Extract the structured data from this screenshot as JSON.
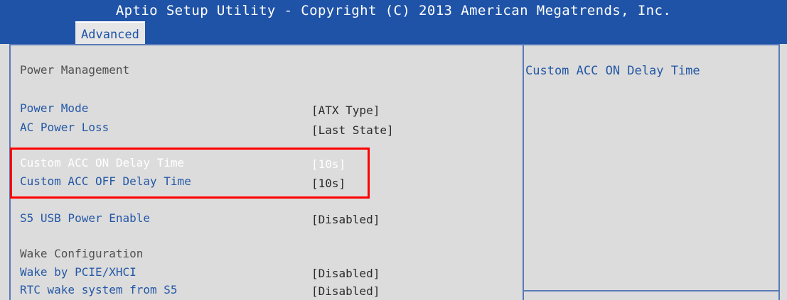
{
  "window": {
    "title": "Aptio Setup Utility - Copyright (C) 2013 American Megatrends, Inc."
  },
  "tabs": [
    {
      "label": "Advanced"
    }
  ],
  "section": {
    "title": "Power Management"
  },
  "settings": {
    "power_mode": {
      "label": "Power Mode",
      "value": "[ATX Type]"
    },
    "ac_power_loss": {
      "label": "AC Power Loss",
      "value": "[Last State]"
    },
    "acc_on_delay": {
      "label": "Custom ACC ON Delay Time",
      "value": "[10s]"
    },
    "acc_off_delay": {
      "label": "Custom ACC OFF Delay Time",
      "value": "[10s]"
    },
    "s5_usb_power": {
      "label": "S5 USB Power Enable",
      "value": "[Disabled]"
    },
    "wake_pcie": {
      "label": "Wake by PCIE/XHCI",
      "value": "[Disabled]"
    },
    "rtc_wake": {
      "label": "RTC wake system from S5",
      "value": "[Disabled]"
    }
  },
  "wake_section": {
    "title": "Wake Configuration"
  },
  "help": {
    "text": "Custom ACC ON Delay Time"
  },
  "colors": {
    "header_bg": "#1f53a8",
    "option_text": "#2458a6",
    "highlight_text": "#ffffff",
    "annotation": "#ff0000"
  }
}
